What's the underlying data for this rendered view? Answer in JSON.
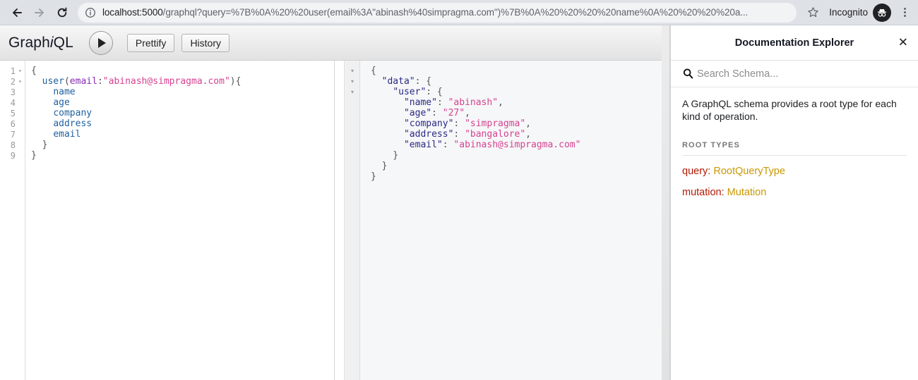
{
  "browser": {
    "url_host": "localhost:5000",
    "url_path": "/graphql?query=%7B%0A%20%20user(email%3A\"abinash%40simpragma.com\")%7B%0A%20%20%20%20name%0A%20%20%20%20a...",
    "incognito_label": "Incognito",
    "icons": {
      "back": "back-arrow-icon",
      "forward": "forward-arrow-icon",
      "reload": "reload-icon",
      "info": "site-info-icon",
      "star": "bookmark-star-icon",
      "incognito": "incognito-icon",
      "menu": "browser-menu-icon"
    }
  },
  "app": {
    "logo_prefix": "Graph",
    "logo_italic": "i",
    "logo_suffix": "QL",
    "execute_title": "Execute Query",
    "prettify_label": "Prettify",
    "history_label": "History"
  },
  "query_editor": {
    "line_numbers": [
      "1",
      "2",
      "3",
      "4",
      "5",
      "6",
      "7",
      "8",
      "9"
    ],
    "fold_markers": [
      "▾",
      "▾",
      "",
      "",
      "",
      "",
      "",
      "",
      ""
    ],
    "lines": [
      [
        {
          "t": "{",
          "c": "t-punct"
        }
      ],
      [
        {
          "t": "  ",
          "c": "t-punct"
        },
        {
          "t": "user",
          "c": "t-field"
        },
        {
          "t": "(",
          "c": "t-punct"
        },
        {
          "t": "email",
          "c": "t-arg"
        },
        {
          "t": ":",
          "c": "t-punct"
        },
        {
          "t": "\"abinash@simpragma.com\"",
          "c": "t-string"
        },
        {
          "t": "){",
          "c": "t-punct"
        }
      ],
      [
        {
          "t": "    ",
          "c": "t-punct"
        },
        {
          "t": "name",
          "c": "t-field"
        }
      ],
      [
        {
          "t": "    ",
          "c": "t-punct"
        },
        {
          "t": "age",
          "c": "t-field"
        }
      ],
      [
        {
          "t": "    ",
          "c": "t-punct"
        },
        {
          "t": "company",
          "c": "t-field"
        }
      ],
      [
        {
          "t": "    ",
          "c": "t-punct"
        },
        {
          "t": "address",
          "c": "t-field"
        }
      ],
      [
        {
          "t": "    ",
          "c": "t-punct"
        },
        {
          "t": "email",
          "c": "t-field"
        }
      ],
      [
        {
          "t": "  }",
          "c": "t-punct"
        }
      ],
      [
        {
          "t": "}",
          "c": "t-punct"
        }
      ]
    ]
  },
  "result_viewer": {
    "fold_markers": [
      "▾",
      "▾",
      "▾",
      "",
      "",
      "",
      "",
      "",
      "",
      "",
      "",
      ""
    ],
    "lines": [
      [
        {
          "t": "{",
          "c": "t-punct"
        }
      ],
      [
        {
          "t": "  ",
          "c": "t-punct"
        },
        {
          "t": "\"data\"",
          "c": "t-key"
        },
        {
          "t": ": {",
          "c": "t-punct"
        }
      ],
      [
        {
          "t": "    ",
          "c": "t-punct"
        },
        {
          "t": "\"user\"",
          "c": "t-key"
        },
        {
          "t": ": {",
          "c": "t-punct"
        }
      ],
      [
        {
          "t": "      ",
          "c": "t-punct"
        },
        {
          "t": "\"name\"",
          "c": "t-key"
        },
        {
          "t": ": ",
          "c": "t-punct"
        },
        {
          "t": "\"abinash\"",
          "c": "t-string"
        },
        {
          "t": ",",
          "c": "t-punct"
        }
      ],
      [
        {
          "t": "      ",
          "c": "t-punct"
        },
        {
          "t": "\"age\"",
          "c": "t-key"
        },
        {
          "t": ": ",
          "c": "t-punct"
        },
        {
          "t": "\"27\"",
          "c": "t-string"
        },
        {
          "t": ",",
          "c": "t-punct"
        }
      ],
      [
        {
          "t": "      ",
          "c": "t-punct"
        },
        {
          "t": "\"company\"",
          "c": "t-key"
        },
        {
          "t": ": ",
          "c": "t-punct"
        },
        {
          "t": "\"simpragma\"",
          "c": "t-string"
        },
        {
          "t": ",",
          "c": "t-punct"
        }
      ],
      [
        {
          "t": "      ",
          "c": "t-punct"
        },
        {
          "t": "\"address\"",
          "c": "t-key"
        },
        {
          "t": ": ",
          "c": "t-punct"
        },
        {
          "t": "\"bangalore\"",
          "c": "t-string"
        },
        {
          "t": ",",
          "c": "t-punct"
        }
      ],
      [
        {
          "t": "      ",
          "c": "t-punct"
        },
        {
          "t": "\"email\"",
          "c": "t-key"
        },
        {
          "t": ": ",
          "c": "t-punct"
        },
        {
          "t": "\"abinash@simpragma.com\"",
          "c": "t-string"
        }
      ],
      [
        {
          "t": "    }",
          "c": "t-punct"
        }
      ],
      [
        {
          "t": "  }",
          "c": "t-punct"
        }
      ],
      [
        {
          "t": "}",
          "c": "t-punct"
        }
      ]
    ]
  },
  "doc_explorer": {
    "title": "Documentation Explorer",
    "close_label": "✕",
    "search_placeholder": "Search Schema...",
    "description": "A GraphQL schema provides a root type for each kind of operation.",
    "section_title": "ROOT TYPES",
    "root_types": [
      {
        "key": "query:",
        "type": "RootQueryType"
      },
      {
        "key": "mutation:",
        "type": "Mutation"
      }
    ]
  },
  "colors": {
    "accent_field": "#1f61a0",
    "accent_string": "#d64292",
    "accent_arg": "#8b2bb9",
    "accent_key": "#2a2a85",
    "root_key": "#b11a04",
    "root_type": "#ca9800"
  }
}
